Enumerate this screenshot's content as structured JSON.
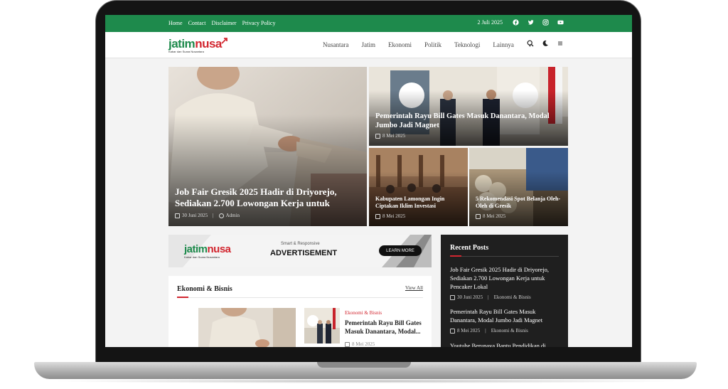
{
  "topbar": {
    "links": [
      "Home",
      "Contact",
      "Disclaimer",
      "Privacy Policy"
    ],
    "date": "2 Juli 2025",
    "social_icons": [
      "facebook-icon",
      "twitter-icon",
      "instagram-icon",
      "youtube-icon"
    ]
  },
  "header": {
    "logo_part1": "jatim",
    "logo_part2": "nusa",
    "logo_tagline": "Kabar dan Suara Nusantara",
    "nav": [
      "Nusantara",
      "Jatim",
      "Ekonomi",
      "Politik",
      "Teknologi",
      "Lainnya"
    ],
    "icons": [
      "search-icon",
      "moon-icon",
      "menu-icon"
    ]
  },
  "hero": {
    "main": {
      "title": "Job Fair Gresik 2025 Hadir di Driyorejo, Sediakan 2.700 Lowongan Kerja untuk",
      "date": "30 Juni 2025",
      "author": "Admin"
    },
    "top_right": {
      "title": "Pemerintah Rayu Bill Gates Masuk Danantara, Modal Jumbo Jadi Magnet",
      "date": "8 Mei 2025"
    },
    "bottom_left": {
      "title": "Kabupaten Lamongan Ingin Ciptakan Iklim Investasi",
      "date": "8 Mei 2025"
    },
    "bottom_right": {
      "title": "5 Rekomendasi Spot Belanja Oleh-Oleh di Gresik",
      "date": "8 Mei 2025"
    }
  },
  "ad": {
    "logo_part1": "jatim",
    "logo_part2": "nusa",
    "tagline": "Kabar dan Suara Nusantara",
    "small": "Smart & Responsive",
    "big": "ADVERTISEMENT",
    "button": "LEARN MORE"
  },
  "section": {
    "title": "Ekonomi & Bisnis",
    "view_all": "View All",
    "item": {
      "category": "Ekonomi & Bisnis",
      "title": "Pemerintah Rayu Bill Gates Masuk Danantara, Modal...",
      "date": "8 Mei 2025"
    }
  },
  "recent": {
    "title": "Recent Posts",
    "posts": [
      {
        "title": "Job Fair Gresik 2025 Hadir di Driyorejo, Sediakan 2.700 Lowongan Kerja untuk Pencaker Lokal",
        "date": "30 Juni 2025",
        "category": "Ekonomi & Bisnis"
      },
      {
        "title": "Pemerintah Rayu Bill Gates Masuk Danantara, Modal Jumbo Jadi Magnet",
        "date": "8 Mei 2025",
        "category": "Ekonomi & Bisnis"
      },
      {
        "title": "Youtube Berupaya Bantu Pendidikan di",
        "date": "",
        "category": ""
      }
    ]
  },
  "colors": {
    "green": "#1e8a4c",
    "red": "#d22730",
    "dark": "#1f1f1f"
  }
}
